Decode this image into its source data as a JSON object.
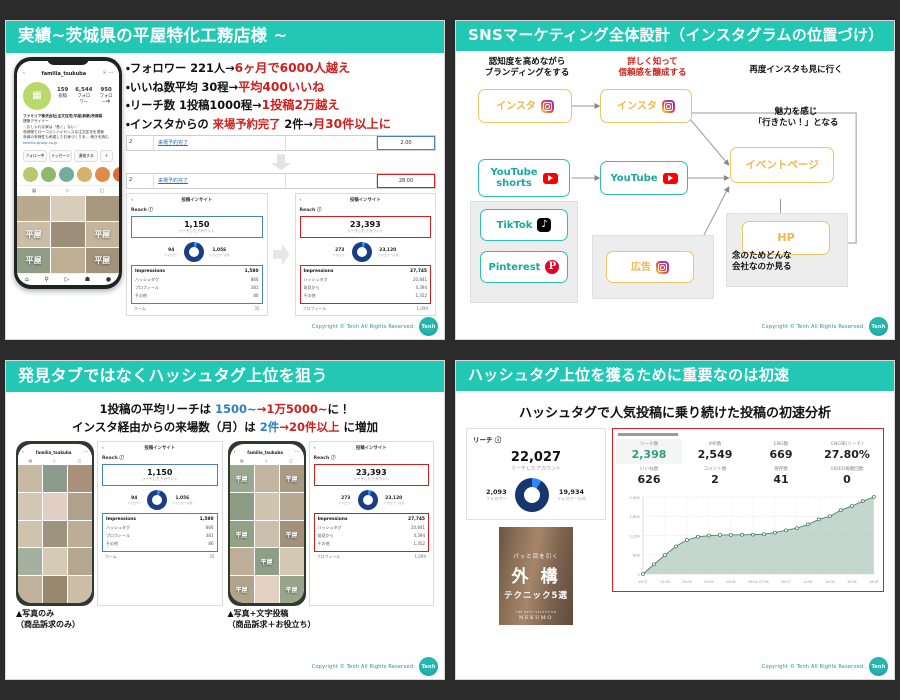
{
  "theme": {
    "accent_teal": "#22c8b4",
    "red": "#d0201d",
    "blue": "#2a7fc9",
    "amber": "#edb74a",
    "background": "#2b2b2b"
  },
  "common": {
    "copyright": "Copyright © Tenh All Rights Reserved.",
    "logo_text": "Tenh"
  },
  "slide1": {
    "title": "実績~茨城県の平屋特化工務店様 ~",
    "bullets": [
      {
        "pre": "・フォロワー 221人→",
        "hi": "6ヶ月で6000人越え"
      },
      {
        "pre": "・いいね数平均 30程→",
        "hi": "平均400いいね"
      },
      {
        "pre": "・リーチ数 1投稿1000程→",
        "hi": "1投稿2万越え"
      },
      {
        "pre": "・インスタからの ",
        "mid": "来場予約完了",
        "post": " 2件→",
        "hi": "月30件以上に"
      }
    ],
    "phone": {
      "handle": "familia_tsukuba",
      "stats": [
        {
          "value": "159",
          "label": "投稿"
        },
        {
          "value": "6,544",
          "label": "フォロワー"
        },
        {
          "value": "950",
          "label": "フォロー中"
        }
      ],
      "avatar_letter": "ﾌｧﾐﾘｱ",
      "bio_title": "ファミリア株式会社|注文住宅|平屋|新築|茨城県",
      "bio_line2": "建築デザイナー",
      "bio_line3": "＼おしゃれな家は「高く」ない／",
      "bio_line4": "茨城県でローコストハイセンスな注文住宅を提案",
      "bio_line5": "茨城の多様性も考慮したお家づくりを... 続きを読む",
      "bio_link": "familia-group.co.jp",
      "buttons": [
        "フォロー中",
        "メッセージ",
        "連絡する",
        "＋"
      ]
    },
    "table_rows": [
      {
        "id": "2",
        "label": "来場予約完了",
        "value": "2.00",
        "style": "blue"
      },
      {
        "id": "2",
        "label": "来場予約完了",
        "value": "28.00",
        "style": "red"
      }
    ],
    "insight_before": {
      "header": "投稿インサイト",
      "reach_label": "Reach ⓘ",
      "reach_value": "1,150",
      "reach_sub": "リーチしたアカウント",
      "donut_left": {
        "value": "94",
        "label": "フォロワー"
      },
      "donut_right": {
        "value": "1,056",
        "label": "フォロワー以外"
      },
      "impressions_label": "Impressions",
      "impressions_value": "1,580",
      "rows": [
        {
          "k": "ハッシュタグ",
          "v": "866"
        },
        {
          "k": "プロフィール",
          "v": "381"
        },
        {
          "k": "その他",
          "v": "86"
        }
      ],
      "extra": {
        "k": "ホーム",
        "v": "35"
      }
    },
    "insight_after": {
      "header": "投稿インサイト",
      "reach_label": "Reach ⓘ",
      "reach_value": "23,393",
      "reach_sub": "リーチしたアカウント",
      "donut_left": {
        "value": "273",
        "label": "フォロワー"
      },
      "donut_right": {
        "value": "23,120",
        "label": "フォロワー以外"
      },
      "impressions_label": "Impressions",
      "impressions_value": "27,745",
      "rows": [
        {
          "k": "ハッシュタグ",
          "v": "20,841"
        },
        {
          "k": "発見から",
          "v": "4,394"
        },
        {
          "k": "その他",
          "v": "1,352"
        }
      ],
      "extra": {
        "k": "プロフィール",
        "v": "1,099"
      }
    }
  },
  "slide2": {
    "title": "SNSマーケティング全体設計（インスタグラムの位置づけ）",
    "captions": [
      {
        "id": "awareness",
        "text": "認知度を高めながら\nブランディングをする",
        "color": "black"
      },
      {
        "id": "trust",
        "text": "詳しく知って\n信頼感を醸成する",
        "color": "red"
      },
      {
        "id": "revisit",
        "text": "再度インスタも見に行く",
        "color": "black"
      },
      {
        "id": "appeal",
        "text": "魅力を感じ\n「行きたい！」となる",
        "color": "black"
      },
      {
        "id": "company-check",
        "text": "念のためどんな\n会社なのか見る",
        "color": "black"
      }
    ],
    "nodes": [
      {
        "id": "insta-1",
        "label": "インスタ",
        "icon": "instagram-icon",
        "style": "amber"
      },
      {
        "id": "insta-2",
        "label": "インスタ",
        "icon": "instagram-icon",
        "style": "amber"
      },
      {
        "id": "youtube-shorts",
        "label": "YouTube\nshorts",
        "icon": "youtube-icon",
        "style": "teal"
      },
      {
        "id": "youtube",
        "label": "YouTube",
        "icon": "youtube-icon",
        "style": "teal"
      },
      {
        "id": "tiktok",
        "label": "TikTok",
        "icon": "tiktok-icon",
        "style": "teal"
      },
      {
        "id": "pinterest",
        "label": "Pinterest",
        "icon": "pinterest-icon",
        "style": "teal"
      },
      {
        "id": "ad",
        "label": "広告",
        "icon": "instagram-icon",
        "style": "amber"
      },
      {
        "id": "event-page",
        "label": "イベントページ",
        "icon": "none",
        "style": "amber"
      },
      {
        "id": "hp",
        "label": "HP",
        "icon": "none",
        "style": "amber"
      }
    ]
  },
  "slide3": {
    "title": "発見タブではなくハッシュタグ上位を狙う",
    "lead_line1": {
      "pre": "1投稿の平均リーチは ",
      "blue": "1500~",
      "arrow": "→",
      "red": "1万5000~",
      "post": "に！"
    },
    "lead_line2": {
      "pre": "インスタ経由からの来場数（月）は ",
      "blue": "2件",
      "arrow": "→",
      "red": "20件以上",
      "post": " に増加"
    },
    "captions": [
      "▲写真のみ\n（商品訴求のみ）",
      "▲写真+文字投稿\n（商品訴求＋お役立ち）"
    ],
    "insight_left": {
      "header": "投稿インサイト",
      "reach_label": "Reach ⓘ",
      "reach_value": "1,150",
      "reach_sub": "リーチしたアカウント",
      "donut_left": {
        "value": "94",
        "label": "フォロワー"
      },
      "donut_right": {
        "value": "1,056",
        "label": "フォロワー以外"
      },
      "impressions_label": "Impressions",
      "impressions_value": "1,580",
      "rows": [
        {
          "k": "ハッシュタグ",
          "v": "866"
        },
        {
          "k": "プロフィール",
          "v": "381"
        },
        {
          "k": "その他",
          "v": "86"
        }
      ],
      "extra": {
        "k": "ホーム",
        "v": "35"
      }
    },
    "insight_right": {
      "header": "投稿インサイト",
      "reach_label": "Reach ⓘ",
      "reach_value": "23,393",
      "reach_sub": "リーチしたアカウント",
      "donut_left": {
        "value": "273",
        "label": "フォロワー"
      },
      "donut_right": {
        "value": "23,120",
        "label": "フォロワー以外"
      },
      "impressions_label": "Impressions",
      "impressions_value": "27,745",
      "rows": [
        {
          "k": "ハッシュタグ",
          "v": "20,841"
        },
        {
          "k": "発見から",
          "v": "4,394"
        },
        {
          "k": "その他",
          "v": "1,352"
        }
      ],
      "extra": {
        "k": "プロフィール",
        "v": "1,099"
      }
    },
    "phone_handle": "familia_tsukuba"
  },
  "slide4": {
    "title": "ハッシュタグ上位を獲るために重要なのは初速",
    "lead": "ハッシュタグで人気投稿に乗り続けた投稿の初速分析",
    "reach_card": {
      "label": "リーチ ⓘ",
      "value": "22,027",
      "sub": "リーチしたアカウント",
      "left": {
        "value": "2,093",
        "label": "フォロワー"
      },
      "right": {
        "value": "19,934",
        "label": "フォロワー以外"
      }
    },
    "book": {
      "line1": "パッと目を引く",
      "line2": "外 構",
      "line3": "テクニック5選",
      "brand": "NEKUMO",
      "brand_small": "THE BEST SELECTION"
    },
    "stats": [
      {
        "key": "リーチ数",
        "value": "2,398",
        "highlight": true
      },
      {
        "key": "IMP数",
        "value": "2,549",
        "highlight": false
      },
      {
        "key": "ENG数",
        "value": "669",
        "highlight": false
      },
      {
        "key": "ENG率(リーチ)",
        "value": "27.80%",
        "highlight": false
      },
      {
        "key": "いいね数",
        "value": "626",
        "highlight": false
      },
      {
        "key": "コメント数",
        "value": "2",
        "highlight": false
      },
      {
        "key": "保存数",
        "value": "41",
        "highlight": false
      },
      {
        "key": "VIDEO視聴回数",
        "value": "0",
        "highlight": false
      }
    ],
    "chart_data": {
      "type": "area",
      "title": "",
      "xlabel": "",
      "ylabel": "",
      "ylim": [
        0,
        2400
      ],
      "yticks": [
        0,
        600,
        1200,
        1800,
        2400
      ],
      "ytick_labels": [
        "0",
        "600",
        "1,200",
        "1,800",
        "2,400"
      ],
      "grid": true,
      "legend": "none",
      "line_color": "#4f7f6f",
      "fill_color": "#b9d0c6",
      "x": [
        "19:07",
        "20:06",
        "21:05",
        "22:05",
        "23:06",
        "00:06",
        "01:05",
        "02:05",
        "03:06",
        "04:06",
        "05:04",
        "06:05",
        "07:06",
        "08:06",
        "09:07",
        "10:06",
        "11:05",
        "12:06",
        "14:06",
        "15:06",
        "16:06",
        "18:05"
      ],
      "xtick_labels": [
        "19:07",
        "21:05",
        "23:06",
        "01:05",
        "03:06",
        "05:04",
        "07:06",
        "09:07",
        "11:05",
        "14:06",
        "16:06",
        "18:05"
      ],
      "values": [
        0,
        300,
        590,
        860,
        1060,
        1160,
        1195,
        1215,
        1220,
        1222,
        1228,
        1240,
        1290,
        1360,
        1430,
        1545,
        1700,
        1800,
        1990,
        2120,
        2270,
        2400
      ]
    }
  }
}
